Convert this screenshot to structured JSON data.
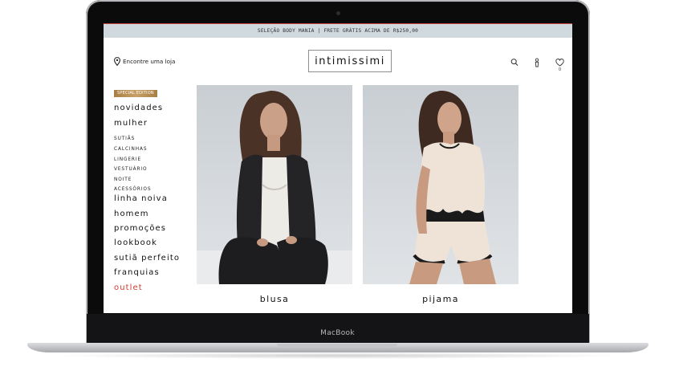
{
  "device": {
    "label": "MacBook"
  },
  "promo_bar": {
    "text": "SELEÇÃO BODY MANIA | FRETE GRÁTIS ACIMA DE R$250,00"
  },
  "header": {
    "store_link": "Encontre uma loja",
    "logo": "intimissimi",
    "wishlist_count": "0",
    "icons": [
      "search-icon",
      "user-icon",
      "heart-icon"
    ]
  },
  "sidebar": {
    "badge": "SPECIAL EDITION",
    "novidades": "novidades",
    "mulher": "mulher",
    "sub_items": [
      "SUTIÃS",
      "CALCINHAS",
      "LINGERIE",
      "VESTUÁRIO",
      "NOITE",
      "ACESSÓRIOS"
    ],
    "items": [
      "linha noiva",
      "homem",
      "promoções",
      "lookbook",
      "sutiã perfeito",
      "franquias",
      "outlet"
    ]
  },
  "products": [
    {
      "label": "blusa"
    },
    {
      "label": "pijama"
    }
  ],
  "colors": {
    "promo_bg": "#cfd9de",
    "promo_accent": "#c8443f",
    "outlet": "#d23b2f",
    "badge_gold": "#b8904f"
  }
}
